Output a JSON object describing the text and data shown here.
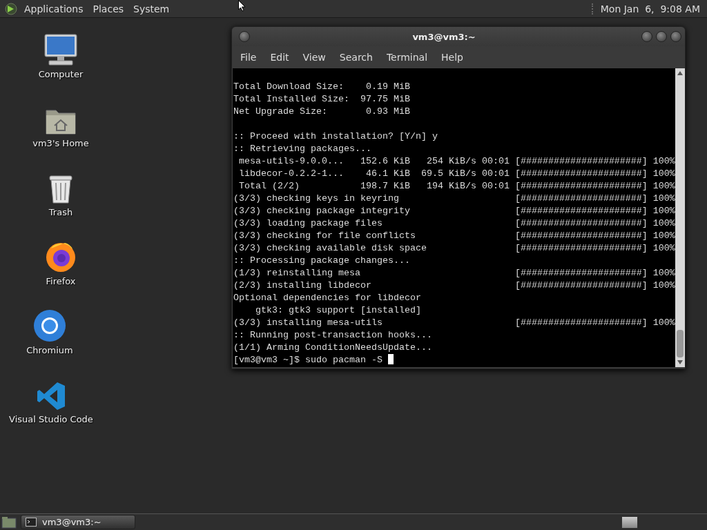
{
  "top_panel": {
    "menus": [
      "Applications",
      "Places",
      "System"
    ],
    "clock": "Mon Jan  6,  9:08 AM"
  },
  "desktop_icons": [
    {
      "kind": "computer",
      "label": "Computer"
    },
    {
      "kind": "home",
      "label": "vm3's Home"
    },
    {
      "kind": "trash",
      "label": "Trash"
    },
    {
      "kind": "fox",
      "label": "Firefox"
    },
    {
      "kind": "chromium",
      "label": "Chromium"
    },
    {
      "kind": "code",
      "label": "Visual Studio Code"
    }
  ],
  "terminal": {
    "title": "vm3@vm3:~",
    "menu": [
      "File",
      "Edit",
      "View",
      "Search",
      "Terminal",
      "Help"
    ],
    "blocks": [
      [
        {
          "kind": "text",
          "text": "Total Download Size:    0.19 MiB"
        },
        {
          "kind": "text",
          "text": "Total Installed Size:  97.75 MiB"
        },
        {
          "kind": "text",
          "text": "Net Upgrade Size:       0.93 MiB"
        }
      ],
      [
        {
          "kind": "text",
          "text": ":: Proceed with installation? [Y/n] y"
        },
        {
          "kind": "text",
          "text": ":: Retrieving packages..."
        },
        {
          "kind": "progress",
          "text": " mesa-utils-9.0.0...   152.6 KiB   254 KiB/s 00:01",
          "bar": "[######################]",
          "percent": "100%"
        },
        {
          "kind": "progress",
          "text": " libdecor-0.2.2-1...    46.1 KiB  69.5 KiB/s 00:01",
          "bar": "[######################]",
          "percent": "100%"
        },
        {
          "kind": "progress",
          "text": " Total (2/2)           198.7 KiB   194 KiB/s 00:01",
          "bar": "[######################]",
          "percent": "100%"
        },
        {
          "kind": "progress",
          "text": "(3/3) checking keys in keyring",
          "bar": "[######################]",
          "percent": "100%"
        },
        {
          "kind": "progress",
          "text": "(3/3) checking package integrity",
          "bar": "[######################]",
          "percent": "100%"
        },
        {
          "kind": "progress",
          "text": "(3/3) loading package files",
          "bar": "[######################]",
          "percent": "100%"
        },
        {
          "kind": "progress",
          "text": "(3/3) checking for file conflicts",
          "bar": "[######################]",
          "percent": "100%"
        },
        {
          "kind": "progress",
          "text": "(3/3) checking available disk space",
          "bar": "[######################]",
          "percent": "100%"
        },
        {
          "kind": "text",
          "text": ":: Processing package changes..."
        },
        {
          "kind": "progress",
          "text": "(1/3) reinstalling mesa",
          "bar": "[######################]",
          "percent": "100%"
        },
        {
          "kind": "progress",
          "text": "(2/3) installing libdecor",
          "bar": "[######################]",
          "percent": "100%"
        },
        {
          "kind": "text",
          "text": "Optional dependencies for libdecor"
        },
        {
          "kind": "text",
          "text": "    gtk3: gtk3 support [installed]"
        },
        {
          "kind": "progress",
          "text": "(3/3) installing mesa-utils",
          "bar": "[######################]",
          "percent": "100%"
        },
        {
          "kind": "text",
          "text": ":: Running post-transaction hooks..."
        },
        {
          "kind": "text",
          "text": "(1/1) Arming ConditionNeedsUpdate..."
        },
        {
          "kind": "prompt",
          "text": "[vm3@vm3 ~]$ sudo pacman -S"
        }
      ]
    ]
  },
  "taskbar": {
    "windows": [
      {
        "label": "vm3@vm3:~",
        "selected": true
      }
    ]
  }
}
